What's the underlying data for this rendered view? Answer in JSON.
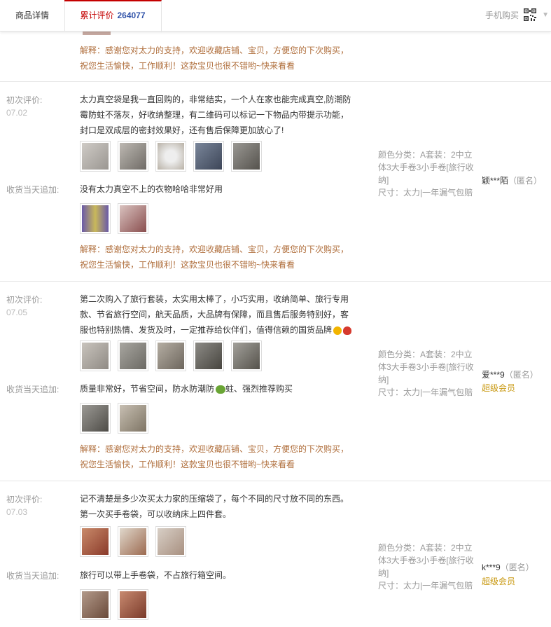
{
  "tabs": {
    "detail": "商品详情",
    "review_label": "累计评价",
    "review_count": "264077",
    "mobile_buy": "手机购买"
  },
  "reviews": [
    {
      "reply": "解释：感谢您对太力的支持，欢迎收藏店铺、宝贝，方便您的下次购买，祝您生活愉快，工作顺利！这款宝贝也很不错哟~快来看看"
    },
    {
      "label_initial": "初次评价:",
      "date": "07.02",
      "text": "太力真空袋是我一直回购的，非常结实，一个人在家也能完成真空,防潮防霉防蛀不落灰，好收纳整理，有二维码可以标记一下物品内带提示功能，封口是双成层的密封效果好，还有售后保障更加放心了!",
      "label_append": "收货当天追加:",
      "append_text": "没有太力真空不上的衣物哈哈非常好用",
      "reply": "解释：感谢您对太力的支持，欢迎收藏店铺、宝贝，方便您的下次购买，祝您生活愉快，工作顺利！这款宝贝也很不错哟~快来看看",
      "sku": "颜色分类：A套装：2中立体3大手卷3小手卷[旅行收纳]",
      "size": "尺寸：太力|一年漏气包赔",
      "user": "颖***陌",
      "anon": "（匿名）"
    },
    {
      "label_initial": "初次评价:",
      "date": "07.05",
      "text": "第二次购入了旅行套装，太实用太棒了，小巧实用，收纳简单、旅行专用款、节省旅行空间，航天品质，大品牌有保障，而且售后服务特别好，客服也特别热情、发货及时，一定推荐给伙伴们，值得信赖的国货品牌",
      "label_append": "收货当天追加:",
      "append_text_a": "质量非常好，节省空间，防水防潮防",
      "append_text_b": "蛀、强烈推荐购买",
      "reply": "解释：感谢您对太力的支持，欢迎收藏店铺、宝贝，方便您的下次购买，祝您生活愉快，工作顺利！这款宝贝也很不错哟~快来看看",
      "sku": "颜色分类：A套装：2中立体3大手卷3小手卷[旅行收纳]",
      "size": "尺寸：太力|一年漏气包赔",
      "user": "爱***9",
      "anon": "（匿名）",
      "vip": "超级会员"
    },
    {
      "label_initial": "初次评价:",
      "date": "07.03",
      "text": "记不清楚是多少次买太力家的压缩袋了，每个不同的尺寸放不同的东西。第一次买手卷袋，可以收纳床上四件套。",
      "label_append": "收货当天追加:",
      "append_text": "旅行可以带上手卷袋，不占旅行箱空间。",
      "sku": "颜色分类：A套装：2中立体3大手卷3小手卷[旅行收纳]",
      "size": "尺寸：太力|一年漏气包赔",
      "user": "k***9",
      "anon": "（匿名）",
      "vip": "超级会员"
    }
  ],
  "colors": {
    "accent_red": "#c40000",
    "count_blue": "#3355aa",
    "reply_brown": "#b06f3d",
    "vip_gold": "#c8980f"
  }
}
